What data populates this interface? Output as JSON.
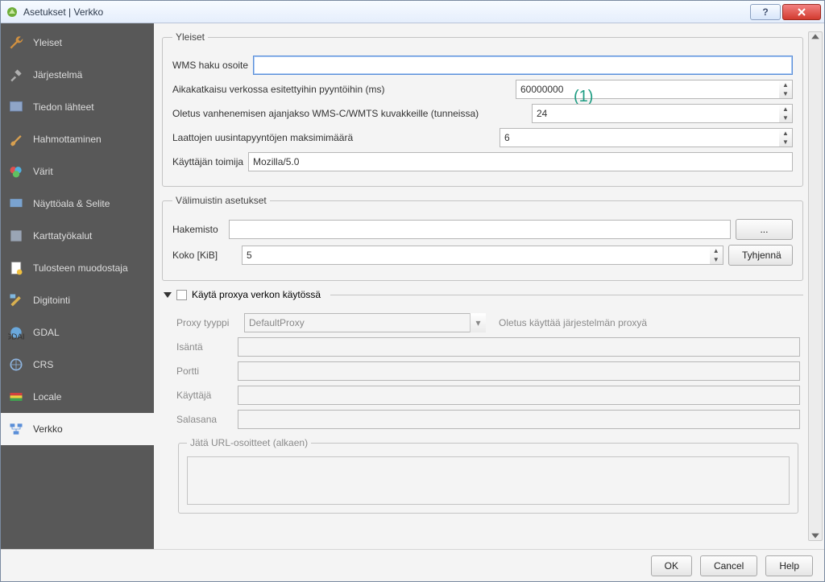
{
  "window": {
    "title": "Asetukset | Verkko"
  },
  "sidebar": {
    "items": [
      {
        "label": "Yleiset",
        "icon": "wrench-icon"
      },
      {
        "label": "Järjestelmä",
        "icon": "tools-icon"
      },
      {
        "label": "Tiedon lähteet",
        "icon": "datasource-icon"
      },
      {
        "label": "Hahmottaminen",
        "icon": "brush-icon"
      },
      {
        "label": "Värit",
        "icon": "colors-icon"
      },
      {
        "label": "Näyttöala & Selite",
        "icon": "canvas-icon"
      },
      {
        "label": "Karttatyökalut",
        "icon": "maptools-icon"
      },
      {
        "label": "Tulosteen muodostaja",
        "icon": "composer-icon"
      },
      {
        "label": "Digitointi",
        "icon": "digitizing-icon"
      },
      {
        "label": "GDAL",
        "icon": "gdal-icon"
      },
      {
        "label": "CRS",
        "icon": "crs-icon"
      },
      {
        "label": "Locale",
        "icon": "locale-icon"
      },
      {
        "label": "Verkko",
        "icon": "network-icon"
      }
    ],
    "active_index": 12
  },
  "general": {
    "legend": "Yleiset",
    "wms_label": "WMS haku osoite",
    "wms_value": "",
    "timeout_label": "Aikakatkaisu verkossa esitettyihin pyyntöihin (ms)",
    "timeout_value": "60000000",
    "expiry_label": "Oletus vanhenemisen ajanjakso WMS-C/WMTS kuvakkeille (tunneissa)",
    "expiry_value": "24",
    "retry_label": "Laattojen uusintapyyntöjen maksimimäärä",
    "retry_value": "6",
    "ua_label": "Käyttäjän toimija",
    "ua_value": "Mozilla/5.0"
  },
  "cache": {
    "legend": "Välimuistin asetukset",
    "dir_label": "Hakemisto",
    "dir_value": "",
    "browse_label": "...",
    "size_label": "Koko [KiB]",
    "size_value": "5",
    "clear_label": "Tyhjennä"
  },
  "proxy": {
    "use_label": "Käytä proxya verkon käytössä",
    "type_label": "Proxy tyyppi",
    "type_value": "DefaultProxy",
    "type_note": "Oletus käyttää järjestelmän proxyä",
    "host_label": "Isäntä",
    "port_label": "Portti",
    "user_label": "Käyttäjä",
    "pass_label": "Salasana",
    "exclude_legend": "Jätä URL-osoitteet (alkaen)"
  },
  "buttons": {
    "ok": "OK",
    "cancel": "Cancel",
    "help": "Help"
  },
  "annotation": "(1)",
  "colors": {
    "accent": "#5a8ed8",
    "annotation": "#1f9d83"
  }
}
